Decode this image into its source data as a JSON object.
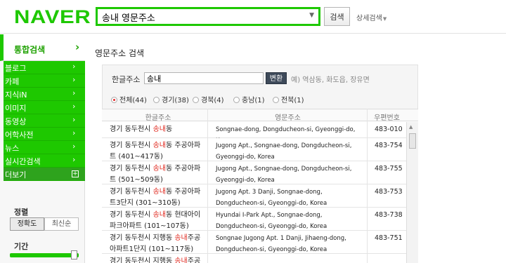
{
  "header": {
    "logo": "NAVER",
    "search_value": "송내 영문주소",
    "dropdown_icon": "▼",
    "search_button": "검색",
    "detail_search": "상세검색",
    "detail_arrow": "▼"
  },
  "sidebar": {
    "top_label": "통합검색",
    "top_arrow": "›",
    "items": [
      {
        "label": "블로그",
        "arrow": "›"
      },
      {
        "label": "카페",
        "arrow": "›"
      },
      {
        "label": "지식iN",
        "arrow": "›"
      },
      {
        "label": "이미지",
        "arrow": "›"
      },
      {
        "label": "동영상",
        "arrow": "›"
      },
      {
        "label": "어학사전",
        "arrow": "›"
      },
      {
        "label": "뉴스",
        "arrow": "›"
      },
      {
        "label": "실시간검색",
        "arrow": "›"
      }
    ],
    "more_label": "더보기",
    "more_icon": "+",
    "sort_title": "정렬",
    "sort_options": [
      "정확도",
      "최신순"
    ],
    "period_title": "기간"
  },
  "main": {
    "title": "영문주소 검색",
    "korean_label": "한글주소",
    "korean_value": "송내",
    "convert_button": "변환",
    "example_hint": "예) 역삼동, 화도읍, 장유면",
    "filters": [
      {
        "label": "전체(44)",
        "selected": true
      },
      {
        "label": "경기(38)",
        "selected": false
      },
      {
        "label": "경북(4)",
        "selected": false
      },
      {
        "label": "충남(1)",
        "selected": false
      },
      {
        "label": "전북(1)",
        "selected": false
      }
    ],
    "table": {
      "headers": [
        "한글주소",
        "영문주소",
        "우편번호"
      ],
      "rows": [
        {
          "kr_pre": "경기 동두천시 ",
          "kr_hl": "송내",
          "kr_post": "동",
          "en": "Songnae-dong, Dongducheon-si, Gyeonggi-do, Korea",
          "zip": "483-010"
        },
        {
          "kr_pre": "경기 동두천시 ",
          "kr_hl": "송내",
          "kr_post": "동 주공아파트 (401~417동)",
          "en": "Jugong Apt., Songnae-dong, Dongducheon-si, Gyeonggi-do, Korea",
          "zip": "483-754"
        },
        {
          "kr_pre": "경기 동두천시 ",
          "kr_hl": "송내",
          "kr_post": "동 주공아파트 (501~509동)",
          "en": "Jugong Apt., Songnae-dong, Dongducheon-si, Gyeonggi-do, Korea",
          "zip": "483-755"
        },
        {
          "kr_pre": "경기 동두천시 ",
          "kr_hl": "송내",
          "kr_post": "동 주공아파트3단지 (301~310동)",
          "en": "Jugong Apt. 3 Danji, Songnae-dong, Dongducheon-si, Gyeonggi-do, Korea",
          "zip": "483-753"
        },
        {
          "kr_pre": "경기 동두천시 ",
          "kr_hl": "송내",
          "kr_post": "동 현대아이파크아파트 (101~107동)",
          "en": "Hyundai I-Park Apt., Songnae-dong, Dongducheon-si, Gyeonggi-do, Korea",
          "zip": "483-738"
        },
        {
          "kr_pre": "경기 동두천시 지행동 ",
          "kr_hl": "송내",
          "kr_post": "주공아파트1단지 (101~117동)",
          "en": "Songnae Jugong Apt. 1 Danji, Jihaeng-dong, Dongducheon-si, Gyeonggi-do, Korea",
          "zip": "483-751"
        },
        {
          "kr_pre": "경기 동두천시 지행동 ",
          "kr_hl": "송내",
          "kr_post": "주공",
          "en": "",
          "zip": ""
        }
      ]
    }
  }
}
